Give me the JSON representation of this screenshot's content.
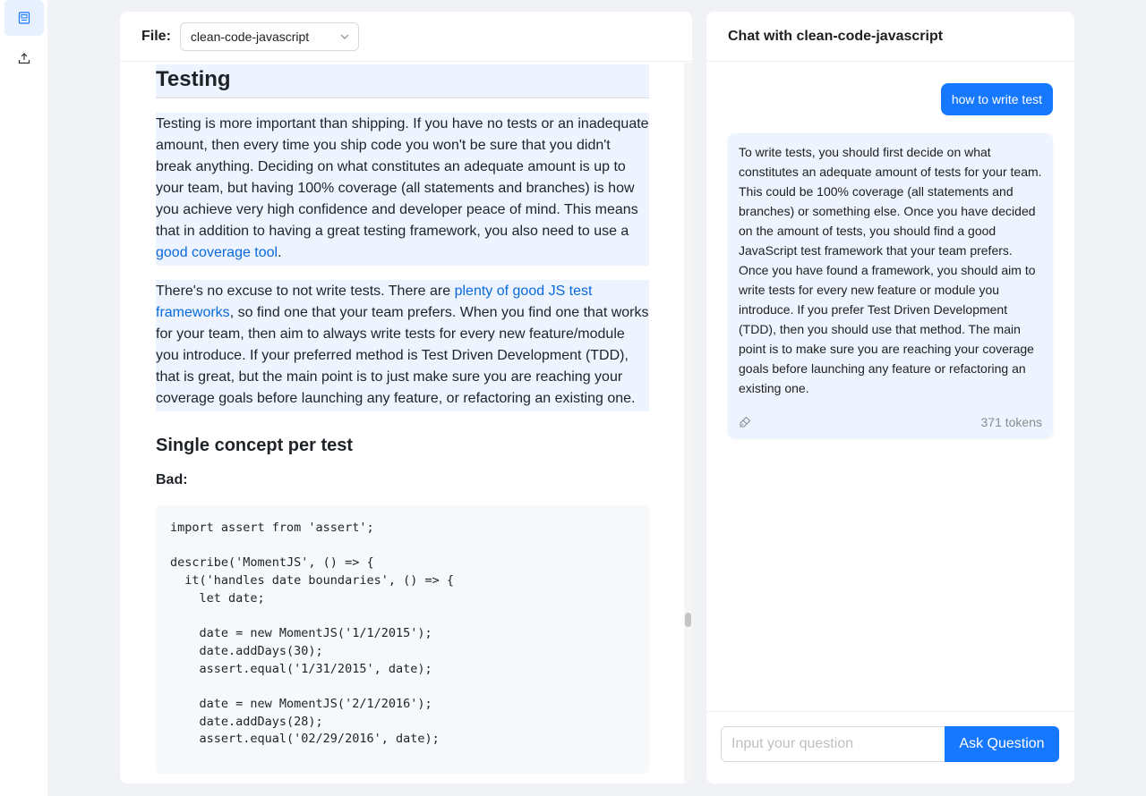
{
  "rail": {
    "items": [
      {
        "icon": "document-icon",
        "active": true
      },
      {
        "icon": "upload-icon",
        "active": false
      }
    ]
  },
  "doc": {
    "file_label": "File:",
    "file_value": "clean-code-javascript",
    "heading": "Testing",
    "p1": {
      "text": "Testing is more important than shipping. If you have no tests or an inadequate amount, then every time you ship code you won't be sure that you didn't break anything. Deciding on what constitutes an adequate amount is up to your team, but having 100% coverage (all statements and branches) is how you achieve very high confidence and developer peace of mind. This means that in addition to having a great testing framework, you also need to use a ",
      "link": "good coverage tool",
      "tail": "."
    },
    "p2": {
      "pre": "There's no excuse to not write tests. There are ",
      "link": "plenty of good JS test frameworks",
      "text": ", so find one that your team prefers. When you find one that works for your team, then aim to always write tests for every new feature/module you introduce. If your preferred method is Test Driven Development (TDD), that is great, but the main point is to just make sure you are reaching your coverage goals before launching any feature, or refactoring an existing one."
    },
    "subheading": "Single concept per test",
    "bad_label": "Bad:",
    "code": "import assert from 'assert';\n\ndescribe('MomentJS', () => {\n  it('handles date boundaries', () => {\n    let date;\n\n    date = new MomentJS('1/1/2015');\n    date.addDays(30);\n    assert.equal('1/31/2015', date);\n\n    date = new MomentJS('2/1/2016');\n    date.addDays(28);\n    assert.equal('02/29/2016', date);"
  },
  "chat": {
    "title": "Chat with clean-code-javascript",
    "user_message": "how to write test",
    "bot_message": "To write tests, you should first decide on what constitutes an adequate amount of tests for your team. This could be 100% coverage (all statements and branches) or something else. Once you have decided on the amount of tests, you should find a good JavaScript test framework that your team prefers. Once you have found a framework, you should aim to write tests for every new feature or module you introduce. If you prefer Test Driven Development (TDD), then you should use that method. The main point is to make sure you are reaching your coverage goals before launching any feature or refactoring an existing one.",
    "tokens": "371 tokens",
    "input_placeholder": "Input your question",
    "input_value": "",
    "ask_label": "Ask Question"
  },
  "colors": {
    "accent": "#1677ff",
    "link": "#0969da",
    "highlight": "#edf4ff",
    "background": "#f0f2f5"
  }
}
